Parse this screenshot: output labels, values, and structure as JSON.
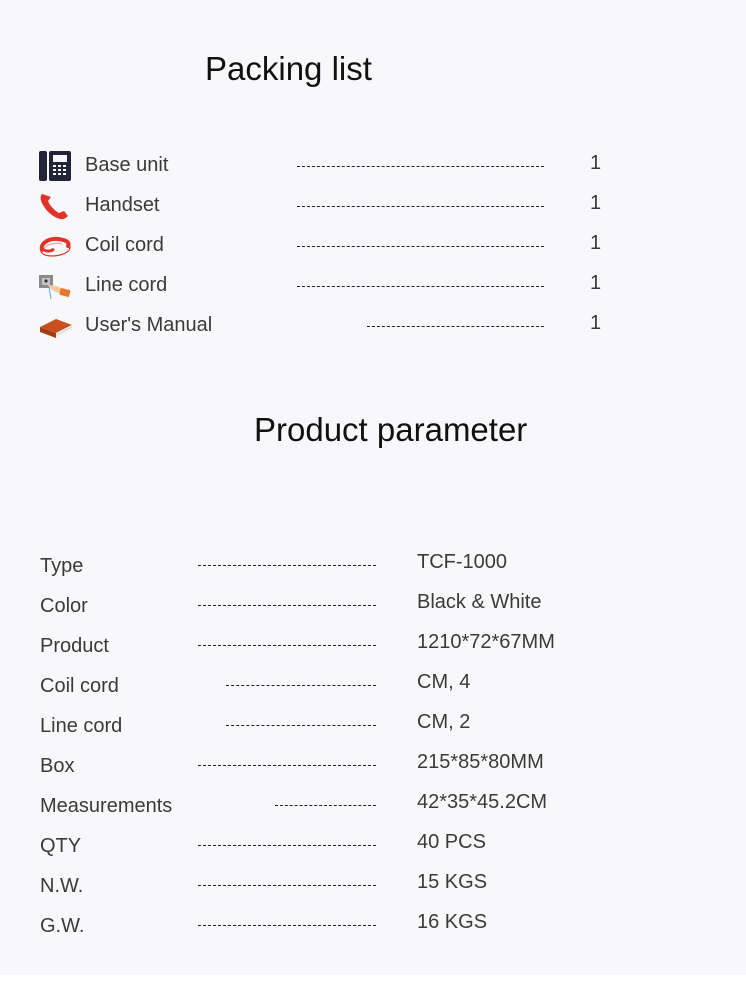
{
  "packing_list": {
    "title": "Packing list",
    "items": [
      {
        "icon": "desk-phone-icon",
        "label": "Base unit",
        "qty": "1"
      },
      {
        "icon": "handset-icon",
        "label": "Handset",
        "qty": "1"
      },
      {
        "icon": "coil-cord-icon",
        "label": "Coil cord",
        "qty": "1"
      },
      {
        "icon": "line-cord-icon",
        "label": "Line cord",
        "qty": "1"
      },
      {
        "icon": "book-icon",
        "label": "User's Manual",
        "qty": "1"
      }
    ]
  },
  "product_parameter": {
    "title": "Product parameter",
    "rows": [
      {
        "label": "Type",
        "value": "TCF-1000"
      },
      {
        "label": "Color",
        "value": "Black & White"
      },
      {
        "label": "Product",
        "value": "1210*72*67MM"
      },
      {
        "label": "Coil cord",
        "value": "CM, 4"
      },
      {
        "label": "Line cord",
        "value": "CM, 2"
      },
      {
        "label": "Box",
        "value": "215*85*80MM"
      },
      {
        "label": "Measurements",
        "value": "42*35*45.2CM"
      },
      {
        "label": "QTY",
        "value": "40 PCS"
      },
      {
        "label": "N.W.",
        "value": "15 KGS"
      },
      {
        "label": "G.W.",
        "value": "16 KGS"
      }
    ]
  },
  "colors": {
    "icon_dark": "#23233a",
    "icon_red": "#e0332a",
    "book_orange": "#c8501e"
  }
}
